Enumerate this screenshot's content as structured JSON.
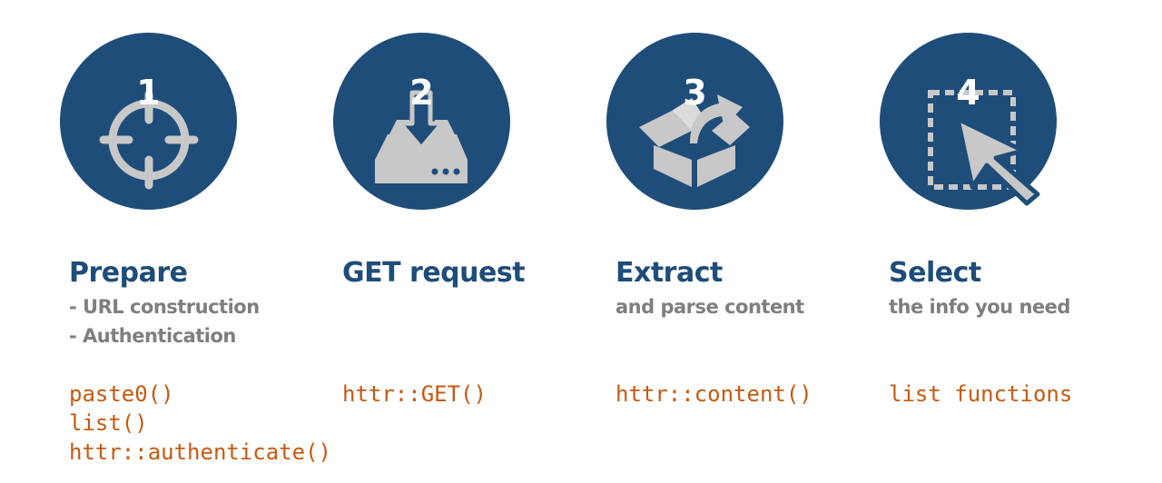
{
  "colors": {
    "circle": "#1f4d79",
    "icon": "#c8c8c8",
    "title": "#1f4d79",
    "subtitle": "#7f7f7f",
    "code": "#c55a11"
  },
  "steps": [
    {
      "number": "1",
      "icon": "crosshair-icon",
      "title": "Prepare",
      "subtitle": [
        "- URL construction",
        "- Authentication"
      ],
      "code": [
        "paste0()",
        "list()",
        "httr::authenticate()"
      ]
    },
    {
      "number": "2",
      "icon": "download-drive-icon",
      "title": "GET request",
      "subtitle": [],
      "code": [
        "httr::GET()"
      ]
    },
    {
      "number": "3",
      "icon": "open-box-icon",
      "title": "Extract",
      "subtitle": [
        "and parse content"
      ],
      "code": [
        "httr::content()"
      ]
    },
    {
      "number": "4",
      "icon": "select-cursor-icon",
      "title": "Select",
      "subtitle": [
        "the info you need"
      ],
      "code": [
        "list functions"
      ]
    }
  ]
}
